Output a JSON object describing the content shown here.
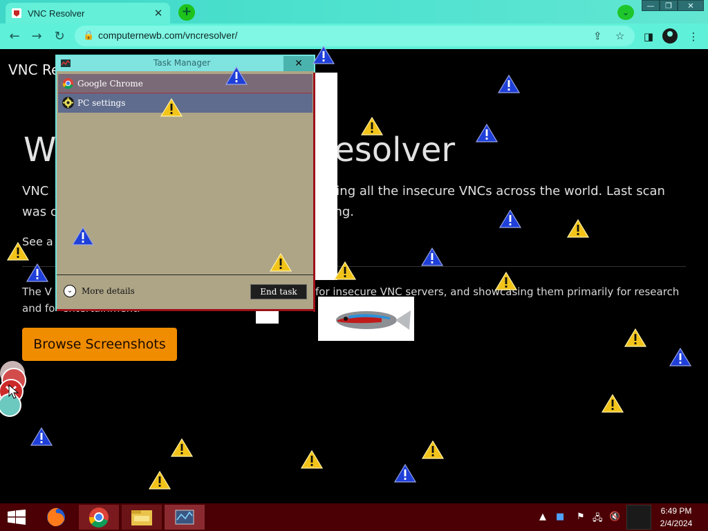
{
  "browser": {
    "tab_title": "VNC Resolver",
    "tab_close": "✕",
    "new_tab": "+",
    "tab_search": "⌄",
    "url": "computernewb.com/vncresolver/",
    "window_buttons": [
      "—",
      "❐",
      "✕"
    ]
  },
  "page": {
    "site_title": "VNC Re",
    "hero_left": "W",
    "hero_right": "Resolver",
    "para1_left": "VNC",
    "para1_right": "casing all the insecure VNCs across the world. Last scan",
    "para2_left": "was c",
    "para2_right": "going.",
    "see_link": "See a",
    "body1_left": "The V",
    "body1_right": "for insecure VNC servers, and showcasing them primarily for research",
    "body2_left": "and fo",
    "body2_mid": "entertainment.",
    "browse_button": "Browse Screenshots"
  },
  "task_manager": {
    "title": "Task Manager",
    "close": "✕",
    "apps": [
      {
        "label": "Google Chrome",
        "icon": "chrome-icon"
      },
      {
        "label": "PC settings",
        "icon": "gear-icon"
      }
    ],
    "more_details": "More details",
    "end_task": "End task"
  },
  "taskbar": {
    "time": "6:49 PM",
    "date": "2/4/2024",
    "apps": [
      "firefox-icon",
      "chrome-icon",
      "file-explorer-icon",
      "task-manager-icon"
    ]
  },
  "colors": {
    "chrome_frame": "#4ee2cf",
    "page_bg": "#000000",
    "button_accent": "#f08c00",
    "taskbar": "#4a0004"
  }
}
